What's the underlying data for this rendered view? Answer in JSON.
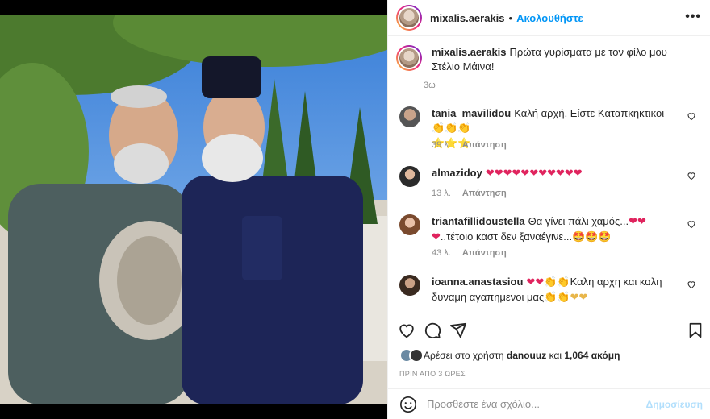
{
  "header": {
    "username": "mixalis.aerakis",
    "separator": "•",
    "follow_label": "Ακολουθήστε",
    "more_label": "•••"
  },
  "caption": {
    "username": "mixalis.aerakis",
    "text": "Πρώτα γυρίσματα με τον φίλο μου Στέλιο Μάινα!",
    "time": "3ω"
  },
  "comments": [
    {
      "username": "tania_mavilidou",
      "text": "Καλή αρχή. Είστε Καταπκηκτικοι",
      "emoji_after": "👏👏👏",
      "line2": "⭐⭐⭐",
      "time": "39 λ.",
      "reply": "Απάντηση"
    },
    {
      "username": "almazidoy",
      "text": "",
      "emoji_after": "❤❤❤❤❤❤❤❤❤❤❤",
      "time": "13 λ.",
      "reply": "Απάντηση"
    },
    {
      "username": "triantafillidoustella",
      "text": "Θα γίνει πάλι χαμός...",
      "emoji_after": "❤❤❤",
      "text2": "..τέτοιο καστ δεν ξαναέγινε...",
      "emoji_end": "🤩🤩🤩",
      "time": "43 λ.",
      "reply": "Απάντηση"
    },
    {
      "username": "ioanna.anastasiou",
      "emoji_before": "❤❤👏👏",
      "text": "Καλη αρχη και καλη δυναμη αγαπημενοι μας",
      "emoji_end": "👏👏❤❤"
    }
  ],
  "likes": {
    "prefix": "Αρέσει στο χρήστη",
    "user": "danouuz",
    "middle": "και",
    "count": "1,064 ακόμη"
  },
  "post_time": "ΠΡΙΝ ΑΠΟ 3 ΩΡΕΣ",
  "add_comment": {
    "placeholder": "Προσθέστε ένα σχόλιο...",
    "publish_label": "Δημοσίευση"
  },
  "icons": {
    "like": "heart-icon",
    "comment": "comment-icon",
    "share": "share-icon",
    "save": "bookmark-icon",
    "emoji": "smiley-icon"
  },
  "colors": {
    "accent": "#0095f6",
    "publish_disabled": "#b2dffc",
    "muted": "#8e8e8e"
  }
}
